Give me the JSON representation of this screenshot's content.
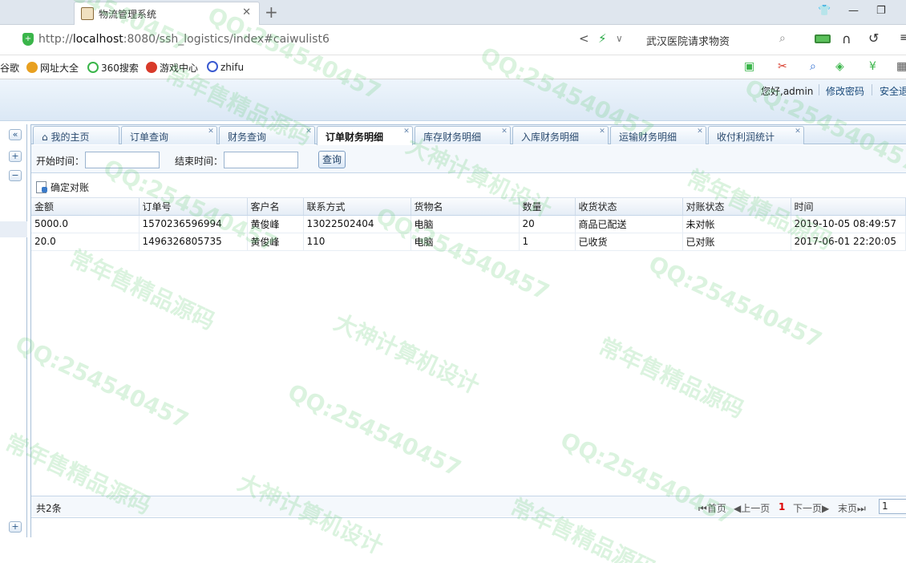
{
  "browser": {
    "tab_title": "物流管理系统",
    "url_prefix": "http://",
    "url_host": "localhost",
    "url_rest": ":8080/ssh_logistics/index#caiwulist6",
    "search_query": "武汉医院请求物资"
  },
  "bookmarks": [
    {
      "label": "谷歌",
      "color": "#4a8ad8"
    },
    {
      "label": "网址大全",
      "color": "#e8a020"
    },
    {
      "label": "360搜索",
      "color": "#3ab54a"
    },
    {
      "label": "游戏中心",
      "color": "#d83a2a"
    },
    {
      "label": "zhifu",
      "color": "#3a5ad0"
    }
  ],
  "header": {
    "welcome": "您好,admin",
    "change_password": "修改密码",
    "logout": "安全退"
  },
  "tabs": [
    {
      "label": "我的主页",
      "closable": false,
      "active": false
    },
    {
      "label": "订单查询",
      "closable": true,
      "active": false
    },
    {
      "label": "财务查询",
      "closable": true,
      "active": false
    },
    {
      "label": "订单财务明细",
      "closable": true,
      "active": true
    },
    {
      "label": "库存财务明细",
      "closable": true,
      "active": false
    },
    {
      "label": "入库财务明细",
      "closable": true,
      "active": false
    },
    {
      "label": "运输财务明细",
      "closable": true,
      "active": false
    },
    {
      "label": "收付利润统计",
      "closable": true,
      "active": false
    }
  ],
  "filter": {
    "start_label": "开始时间：",
    "end_label": "结束时间：",
    "start_value": "",
    "end_value": "",
    "query_button": "查询"
  },
  "toolbar": {
    "confirm_button": "确定对账"
  },
  "table": {
    "columns": [
      "金额",
      "订单号",
      "客户名",
      "联系方式",
      "货物名",
      "数量",
      "收货状态",
      "对账状态",
      "时间"
    ],
    "rows": [
      [
        "5000.0",
        "1570236596994",
        "黄俊峰",
        "13022502404",
        "电脑",
        "20",
        "商品已配送",
        "未对帐",
        "2019-10-05 08:49:57"
      ],
      [
        "20.0",
        "1496326805735",
        "黄俊峰",
        "110",
        "电脑",
        "1",
        "已收货",
        "已对账",
        "2017-06-01 22:20:05"
      ]
    ]
  },
  "pager": {
    "total": "共2条",
    "first": "首页",
    "prev": "上一页",
    "current": "1",
    "next": "下一页",
    "last": "末页",
    "page_input": "1"
  },
  "watermark": {
    "qq": "QQ:254540457",
    "slogan1": "常年售精品源码",
    "slogan2": "大神计算机设计"
  }
}
